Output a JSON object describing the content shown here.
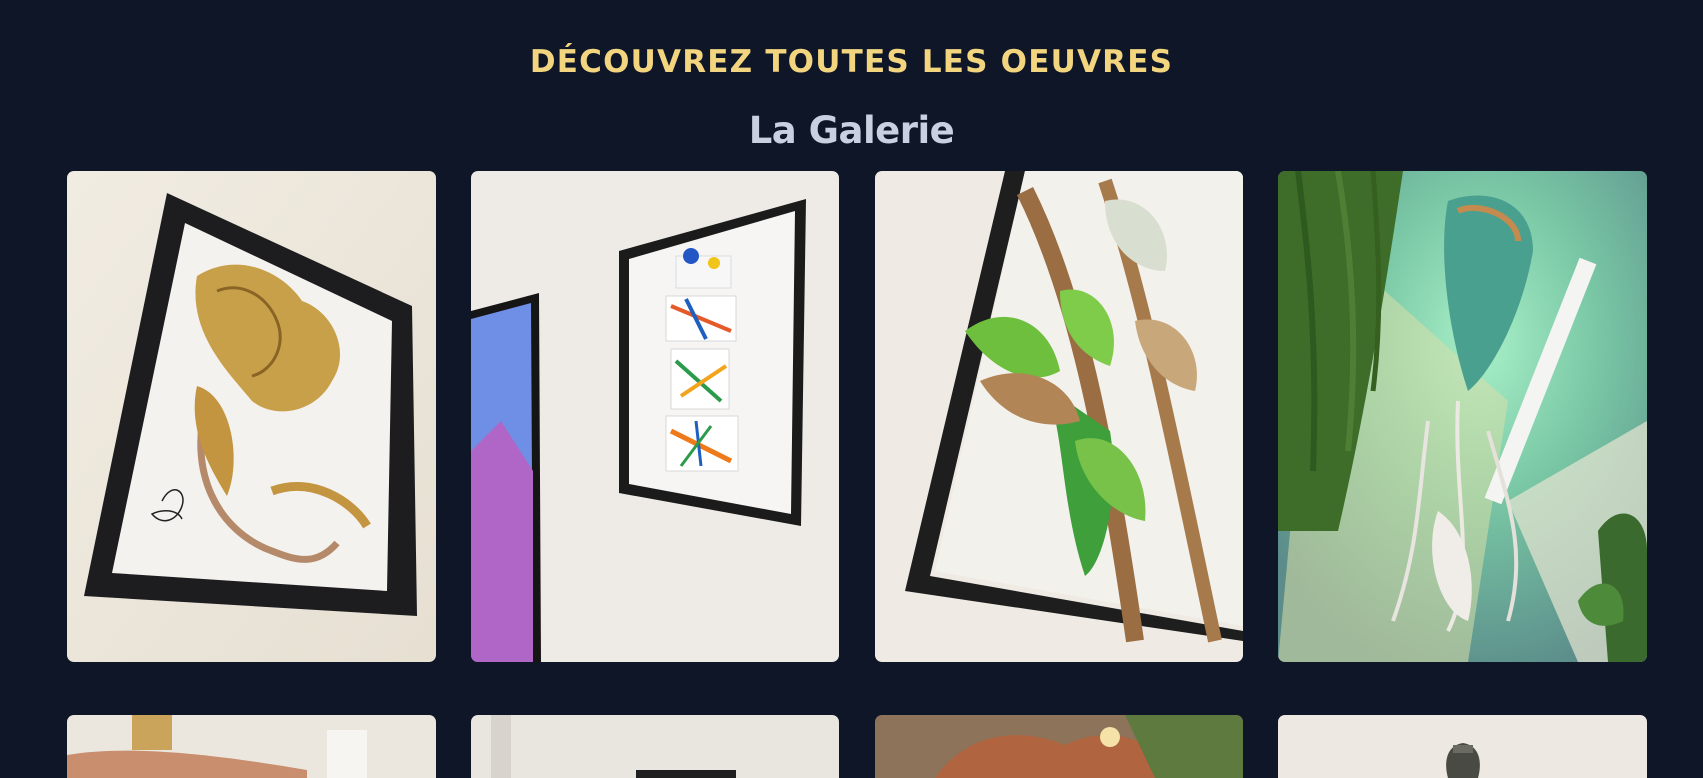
{
  "gallery": {
    "eyebrow": "DÉCOUVREZ TOUTES LES OEUVRES",
    "title": "La Galerie"
  },
  "colors": {
    "background": "#0e1628",
    "eyebrow": "#f2d57e",
    "title": "#c9d0df"
  }
}
